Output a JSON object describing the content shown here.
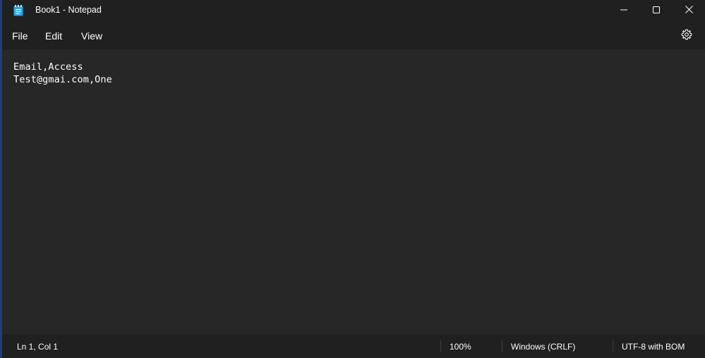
{
  "window": {
    "title": "Book1 - Notepad",
    "app_icon": "notepad-icon"
  },
  "titlebar_buttons": {
    "minimize_icon": "minimize-icon",
    "maximize_icon": "maximize-icon",
    "close_icon": "close-icon"
  },
  "menu": {
    "file": "File",
    "edit": "Edit",
    "view": "View",
    "settings_icon": "gear-icon"
  },
  "editor": {
    "lines": [
      "Email,Access",
      "Test@gmai.com,One"
    ]
  },
  "status": {
    "position": "Ln 1, Col 1",
    "zoom": "100%",
    "line_ending": "Windows (CRLF)",
    "encoding": "UTF-8 with BOM"
  },
  "colors": {
    "chrome": "#202020",
    "editor_bg": "#272727",
    "text": "#ffffff",
    "icon_accent": "#2aa3e0"
  }
}
